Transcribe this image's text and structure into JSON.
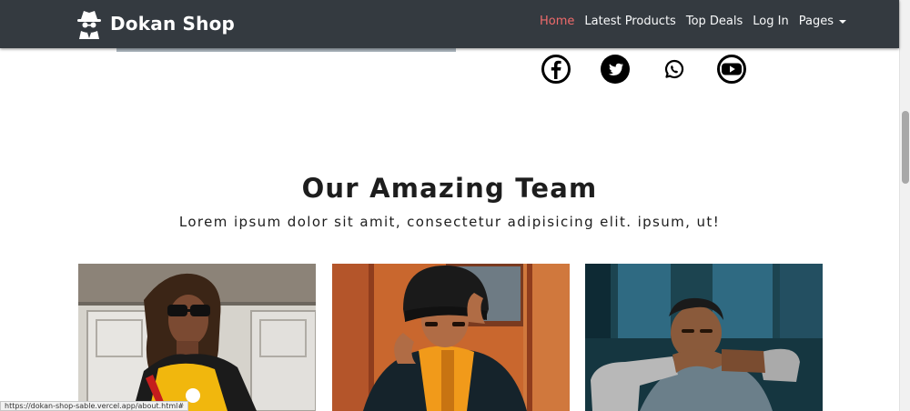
{
  "navbar": {
    "brand": "Dokan Shop",
    "links": [
      {
        "label": "Home",
        "active": true
      },
      {
        "label": "Latest Products",
        "active": false
      },
      {
        "label": "Top Deals",
        "active": false
      },
      {
        "label": "Log In",
        "active": false
      },
      {
        "label": "Pages",
        "active": false,
        "dropdown": true
      }
    ]
  },
  "social": [
    "facebook-icon",
    "twitter-icon",
    "whatsapp-icon",
    "youtube-icon"
  ],
  "team": {
    "title": "Our Amazing Team",
    "subtitle": "Lorem ipsum dolor sit amit, consectetur adipisicing elit. ipsum, ut!"
  },
  "statusbar": {
    "url": "https://dokan-shop-sable.vercel.app/about.html#"
  },
  "colors": {
    "navbar_bg": "#343a40",
    "active_link": "#ef6b6b",
    "heading": "#1d1d1d"
  }
}
